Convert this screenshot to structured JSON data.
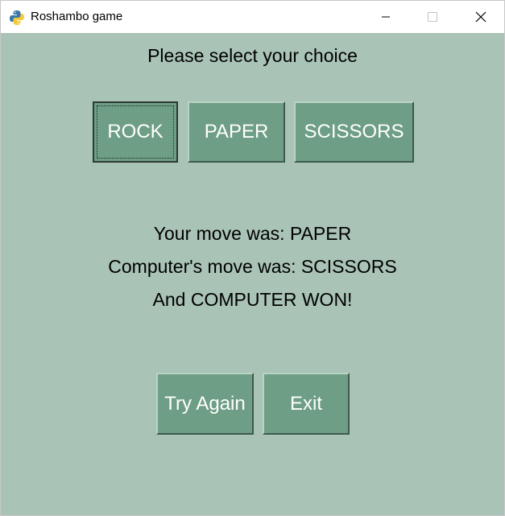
{
  "window": {
    "title": "Roshambo game"
  },
  "game": {
    "prompt": "Please select your choice",
    "choices": {
      "rock": "ROCK",
      "paper": "PAPER",
      "scissors": "SCISSORS"
    },
    "result": {
      "your_move": "Your move was: PAPER",
      "computer_move": "Computer's move was: SCISSORS",
      "outcome": "And COMPUTER WON!"
    },
    "actions": {
      "try_again": "Try Again",
      "exit": "Exit"
    }
  },
  "colors": {
    "background": "#a9c3b6",
    "button": "#6e9e85",
    "button_text": "#ffffff"
  }
}
